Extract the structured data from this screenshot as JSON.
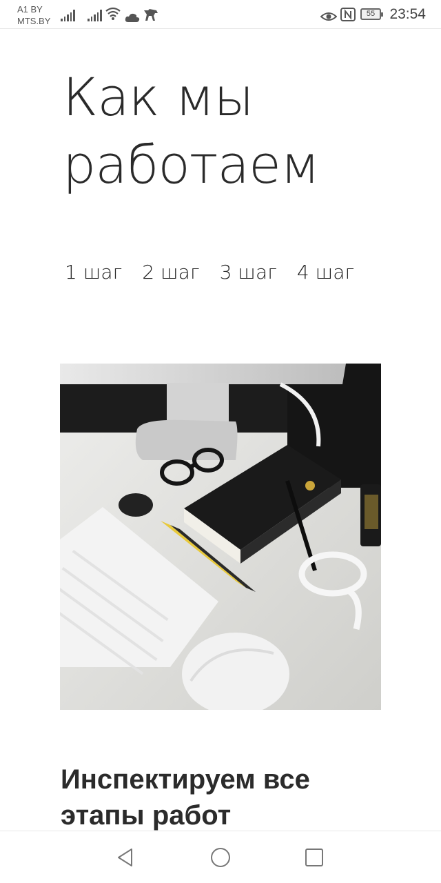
{
  "status_bar": {
    "carrier_line1": "A1 BY",
    "carrier_line2": "MTS.BY",
    "battery": "55",
    "time": "23:54",
    "icons": [
      "signal-icon",
      "signal-icon",
      "wifi-icon",
      "cloud-icon",
      "dog-icon",
      "eye-icon",
      "nfc-icon",
      "battery-icon"
    ]
  },
  "page": {
    "title": "Как мы работаем",
    "steps": [
      "1 шаг",
      "2 шаг",
      "3 шаг",
      "4 шаг"
    ],
    "section_heading": "Инспектируем все этапы работ"
  },
  "nav": {
    "icons": [
      "back-icon",
      "home-icon",
      "recents-icon"
    ]
  },
  "colors": {
    "text": "#222222",
    "accent": "#e8c93a"
  }
}
